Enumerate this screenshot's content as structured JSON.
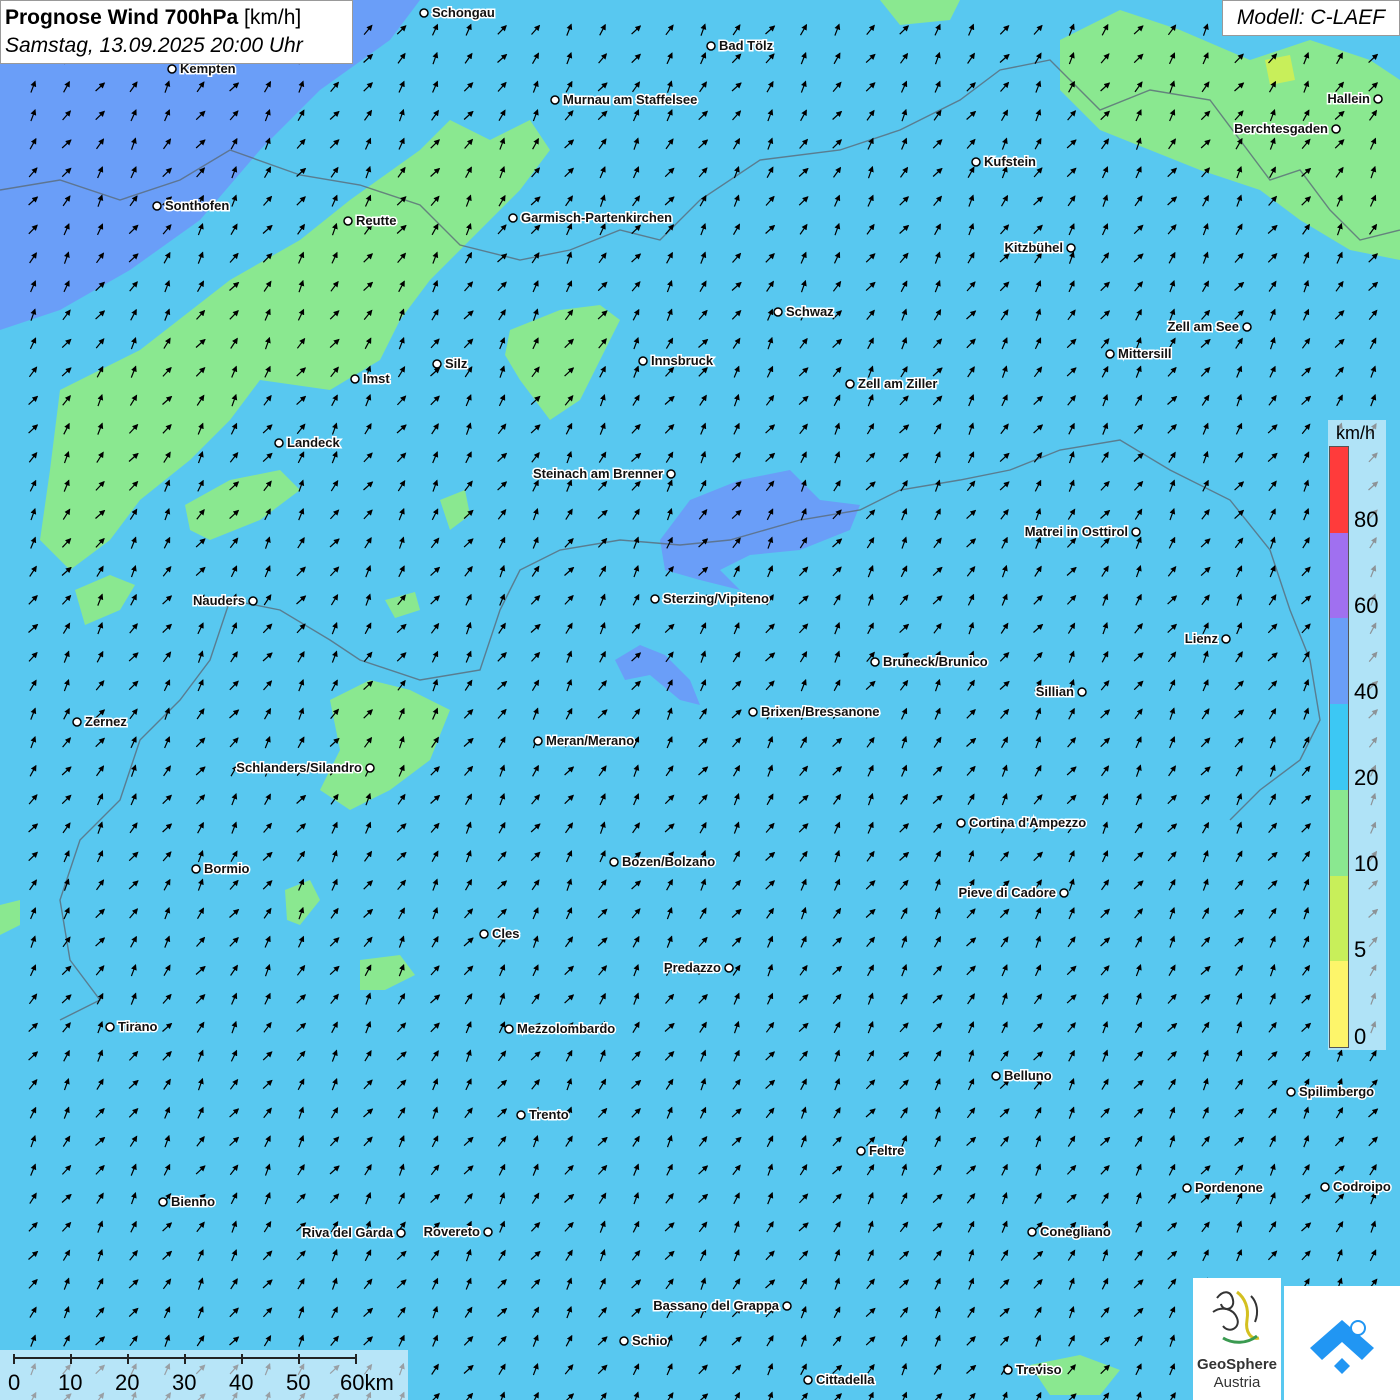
{
  "title": {
    "main": "Prognose Wind 700hPa",
    "unit": "[km/h]",
    "datetime": "Samstag, 13.09.2025 20:00 Uhr"
  },
  "model_label": "Modell: C-LAEF",
  "legend": {
    "unit": "km/h",
    "labels": [
      "80",
      "60",
      "40",
      "20",
      "10",
      "5",
      "0"
    ],
    "colors": [
      "#ff3b3b",
      "#a070f0",
      "#6a9ef8",
      "#3cc8f4",
      "#8ae890",
      "#c8ef5a",
      "#fdf56a"
    ]
  },
  "scale_bar": {
    "labels": [
      "0",
      "10",
      "20",
      "30",
      "40",
      "50",
      "60km"
    ]
  },
  "logos": {
    "geosphere_line1": "GeoSphere",
    "geosphere_line2": "Austria"
  },
  "wind": {
    "dominant_direction": "southwest",
    "dominant_speed_class_kmh": "20-40"
  },
  "cities": [
    {
      "name": "Schongau"
    },
    {
      "name": "Kempten"
    },
    {
      "name": "Bad Tölz"
    },
    {
      "name": "Murnau am Staffelsee"
    },
    {
      "name": "Hallein"
    },
    {
      "name": "Berchtesgaden"
    },
    {
      "name": "Kufstein"
    },
    {
      "name": "Sonthofen"
    },
    {
      "name": "Reutte"
    },
    {
      "name": "Garmisch-Partenkirchen"
    },
    {
      "name": "Kitzbühel"
    },
    {
      "name": "Schwaz"
    },
    {
      "name": "Zell am See"
    },
    {
      "name": "Innsbruck"
    },
    {
      "name": "Mittersill"
    },
    {
      "name": "Silz"
    },
    {
      "name": "Imst"
    },
    {
      "name": "Zell am Ziller"
    },
    {
      "name": "Landeck"
    },
    {
      "name": "Steinach am Brenner"
    },
    {
      "name": "Matrei in Osttirol"
    },
    {
      "name": "Nauders"
    },
    {
      "name": "Sterzing/Vipiteno"
    },
    {
      "name": "Lienz"
    },
    {
      "name": "Bruneck/Brunico"
    },
    {
      "name": "Sillian"
    },
    {
      "name": "Brixen/Bressanone"
    },
    {
      "name": "Zernez"
    },
    {
      "name": "Meran/Merano"
    },
    {
      "name": "Schlanders/Silandro"
    },
    {
      "name": "Cortina d'Ampezzo"
    },
    {
      "name": "Bozen/Bolzano"
    },
    {
      "name": "Bormio"
    },
    {
      "name": "Pieve di Cadore"
    },
    {
      "name": "Cles"
    },
    {
      "name": "Predazzo"
    },
    {
      "name": "Tirano"
    },
    {
      "name": "Mezzolombardo"
    },
    {
      "name": "Belluno"
    },
    {
      "name": "Spilimbergo"
    },
    {
      "name": "Trento"
    },
    {
      "name": "Feltre"
    },
    {
      "name": "Pordenone"
    },
    {
      "name": "Codroipo"
    },
    {
      "name": "Bienno"
    },
    {
      "name": "Riva del Garda"
    },
    {
      "name": "Rovereto"
    },
    {
      "name": "Conegliano"
    },
    {
      "name": "Bassano del Grappa"
    },
    {
      "name": "Schio"
    },
    {
      "name": "Treviso"
    },
    {
      "name": "Cittadella"
    }
  ]
}
